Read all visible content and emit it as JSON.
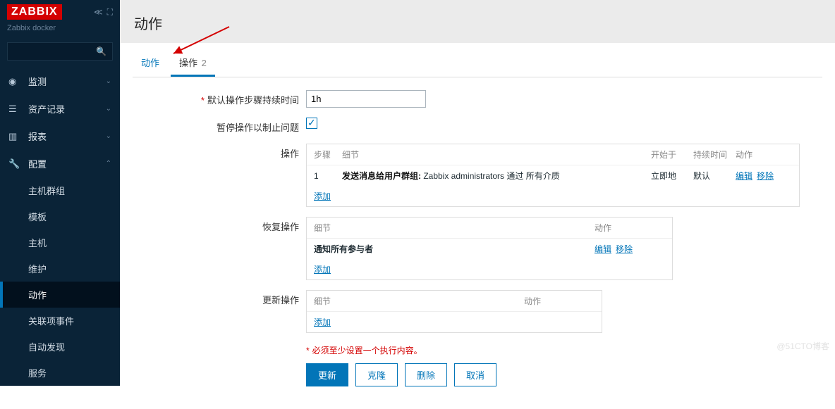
{
  "brand": {
    "logo": "ZABBIX",
    "subtitle": "Zabbix docker"
  },
  "sidebar": {
    "items": [
      {
        "icon": "eye",
        "label": "监测"
      },
      {
        "icon": "list",
        "label": "资产记录"
      },
      {
        "icon": "bar",
        "label": "报表"
      },
      {
        "icon": "wrench",
        "label": "配置"
      }
    ],
    "config_children": [
      "主机群组",
      "模板",
      "主机",
      "维护",
      "动作",
      "关联项事件",
      "自动发现",
      "服务"
    ]
  },
  "page": {
    "title": "动作"
  },
  "tabs": [
    {
      "label": "动作",
      "count": ""
    },
    {
      "label": "操作",
      "count": "2"
    }
  ],
  "form": {
    "duration_label": "默认操作步骤持续时间",
    "duration_value": "1h",
    "pause_label": "暂停操作以制止问题",
    "pause_checked": true,
    "ops_label": "操作",
    "ops_header": {
      "step": "步骤",
      "detail": "细节",
      "start": "开始于",
      "duration": "持续时间",
      "action": "动作"
    },
    "ops_row": {
      "step": "1",
      "detail_bold": "发送消息给用户群组:",
      "detail_rest": " Zabbix administrators 通过 所有介质",
      "start": "立即地",
      "duration": "默认",
      "edit": "编辑",
      "remove": "移除"
    },
    "add": "添加",
    "recovery_label": "恢复操作",
    "recovery_header": {
      "detail": "细节",
      "action": "动作"
    },
    "recovery_row": {
      "detail": "通知所有参与者",
      "edit": "编辑",
      "remove": "移除"
    },
    "update_label": "更新操作",
    "update_header": {
      "detail": "细节",
      "action": "动作"
    },
    "hint": "必须至少设置一个执行内容。",
    "buttons": {
      "update": "更新",
      "clone": "克隆",
      "delete": "删除",
      "cancel": "取消"
    }
  },
  "watermark": "@51CTO博客"
}
